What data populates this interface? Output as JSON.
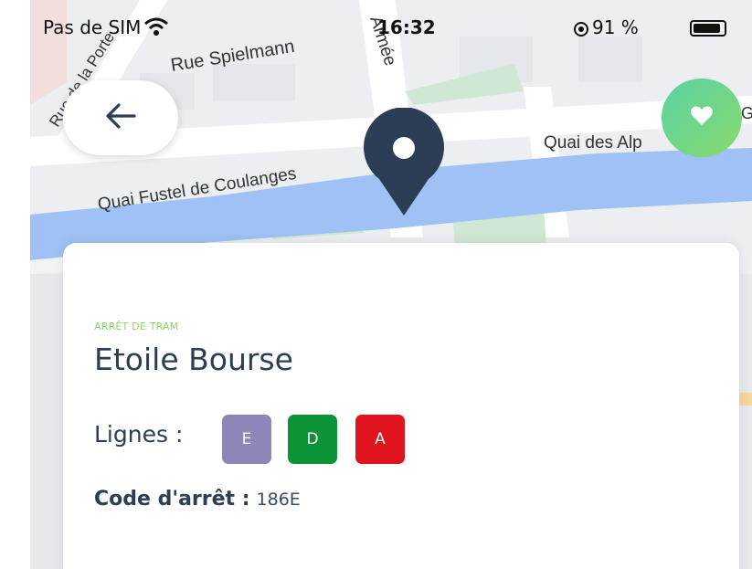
{
  "status_bar": {
    "carrier": "Pas de SIM",
    "time": "16:32",
    "battery_percent_text": "91 %",
    "battery_level": 0.91,
    "icons": [
      "wifi-icon",
      "location-icon",
      "battery-icon"
    ]
  },
  "map": {
    "street_labels": [
      "Rue Spielmann",
      "Quai Fustel de Coulanges",
      "Quai des Alp",
      "Rue de la Porte",
      "Armée",
      "G"
    ],
    "colors": {
      "water": "#9fc1f4",
      "land": "#eceef1",
      "park": "#cfe8d3",
      "road": "#ffffff"
    }
  },
  "back_button": {
    "icon": "arrow-left-icon"
  },
  "favorite_button": {
    "icon": "heart-icon",
    "colors": [
      "#58d3a4",
      "#8ad96d"
    ]
  },
  "map_pin": {
    "icon": "map-pin-icon",
    "color": "#2b3e55"
  },
  "stop_card": {
    "category": "ARRÊT DE TRAM",
    "name": "Etoile Bourse",
    "lines_label": "Lignes :",
    "lines": [
      {
        "label": "E",
        "color": "#8e85b8"
      },
      {
        "label": "D",
        "color": "#0c9336"
      },
      {
        "label": "A",
        "color": "#e0141e"
      }
    ],
    "code_label": "Code d'arrêt :",
    "code_value": "186E"
  }
}
